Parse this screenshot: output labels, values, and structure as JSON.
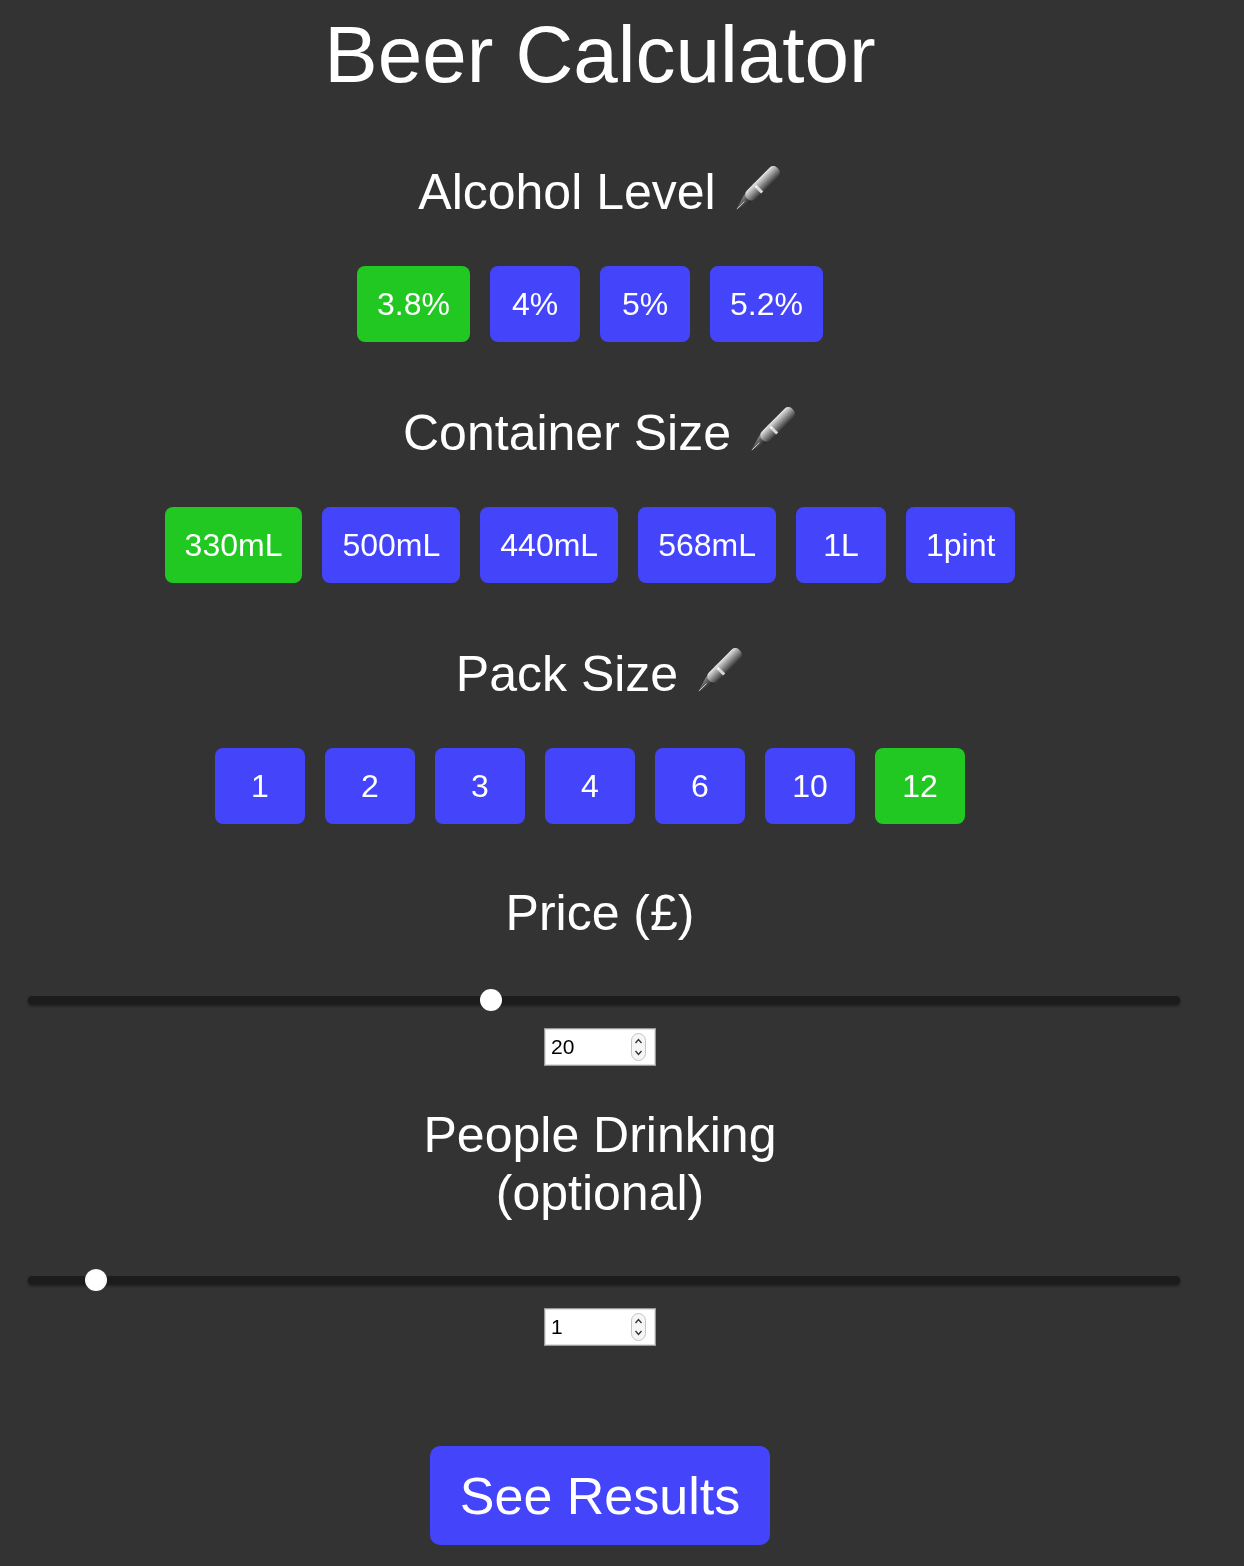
{
  "title": "Beer Calculator",
  "sections": [
    {
      "kind": "options",
      "heading": "Alcohol Level",
      "options": [
        {
          "label": "3.8%",
          "selected": true
        },
        {
          "label": "4%",
          "selected": false
        },
        {
          "label": "5%",
          "selected": false
        },
        {
          "label": "5.2%",
          "selected": false
        }
      ]
    },
    {
      "kind": "options",
      "heading": "Container Size",
      "options": [
        {
          "label": "330mL",
          "selected": true
        },
        {
          "label": "500mL",
          "selected": false
        },
        {
          "label": "440mL",
          "selected": false
        },
        {
          "label": "568mL",
          "selected": false
        },
        {
          "label": "1L",
          "selected": false
        },
        {
          "label": "1pint",
          "selected": false
        }
      ]
    },
    {
      "kind": "options",
      "heading": "Pack Size",
      "options": [
        {
          "label": "1",
          "selected": false
        },
        {
          "label": "2",
          "selected": false
        },
        {
          "label": "3",
          "selected": false
        },
        {
          "label": "4",
          "selected": false
        },
        {
          "label": "6",
          "selected": false
        },
        {
          "label": "10",
          "selected": false
        },
        {
          "label": "12",
          "selected": true
        }
      ]
    },
    {
      "kind": "slider",
      "heading": "Price (£)",
      "level": 0.4,
      "value": "20"
    },
    {
      "kind": "slider",
      "heading": "People Drinking (optional)",
      "level": 0.05,
      "value": "1"
    }
  ],
  "submit": "See Results"
}
